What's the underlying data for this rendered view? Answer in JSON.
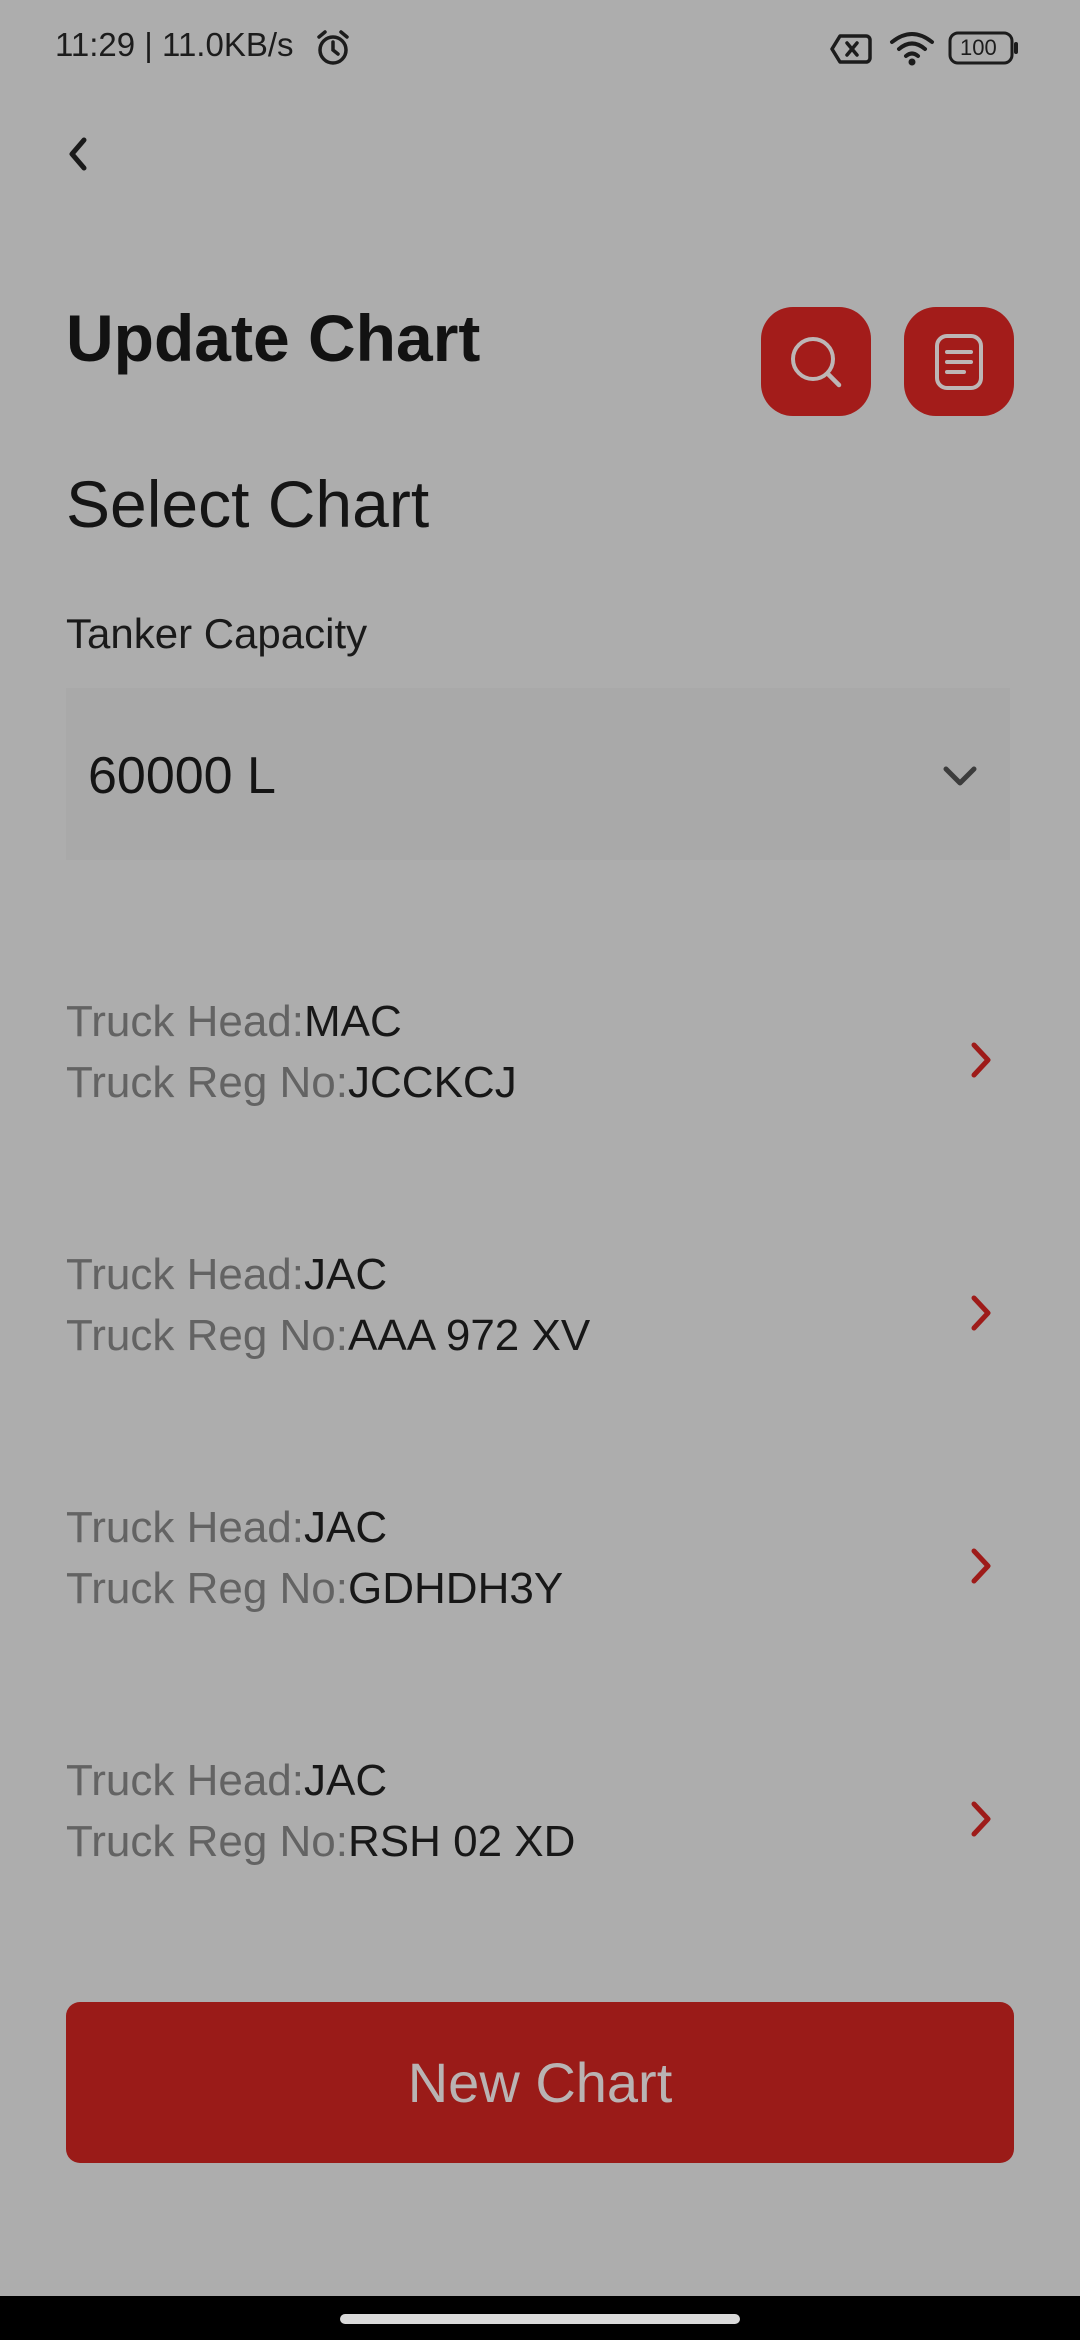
{
  "status_bar": {
    "time_speed": "11:29 | 11.0KB/s",
    "battery": "100"
  },
  "header": {
    "title": "Update Chart"
  },
  "section": {
    "title": "Select Chart"
  },
  "tanker": {
    "label": "Tanker Capacity",
    "selected": "60000 L"
  },
  "trucks": [
    {
      "head_label": "Truck Head:",
      "head": "MAC",
      "reg_label": "Truck Reg No:",
      "reg": "JCCKCJ"
    },
    {
      "head_label": "Truck Head:",
      "head": "JAC",
      "reg_label": "Truck Reg No:",
      "reg": "AAA 972 XV"
    },
    {
      "head_label": "Truck Head:",
      "head": "JAC",
      "reg_label": "Truck Reg No:",
      "reg": "GDHDH3Y"
    },
    {
      "head_label": "Truck Head:",
      "head": "JAC",
      "reg_label": "Truck Reg No:",
      "reg": "RSH 02 XD"
    }
  ],
  "actions": {
    "new_chart_label": "New Chart"
  },
  "colors": {
    "accent": "#a31c1a",
    "overlay_background": "#adadad"
  },
  "icons": {
    "back": "chevron-left-icon",
    "search": "search-icon",
    "document": "document-icon",
    "dropdown": "chevron-down-icon",
    "row": "chevron-right-icon"
  }
}
